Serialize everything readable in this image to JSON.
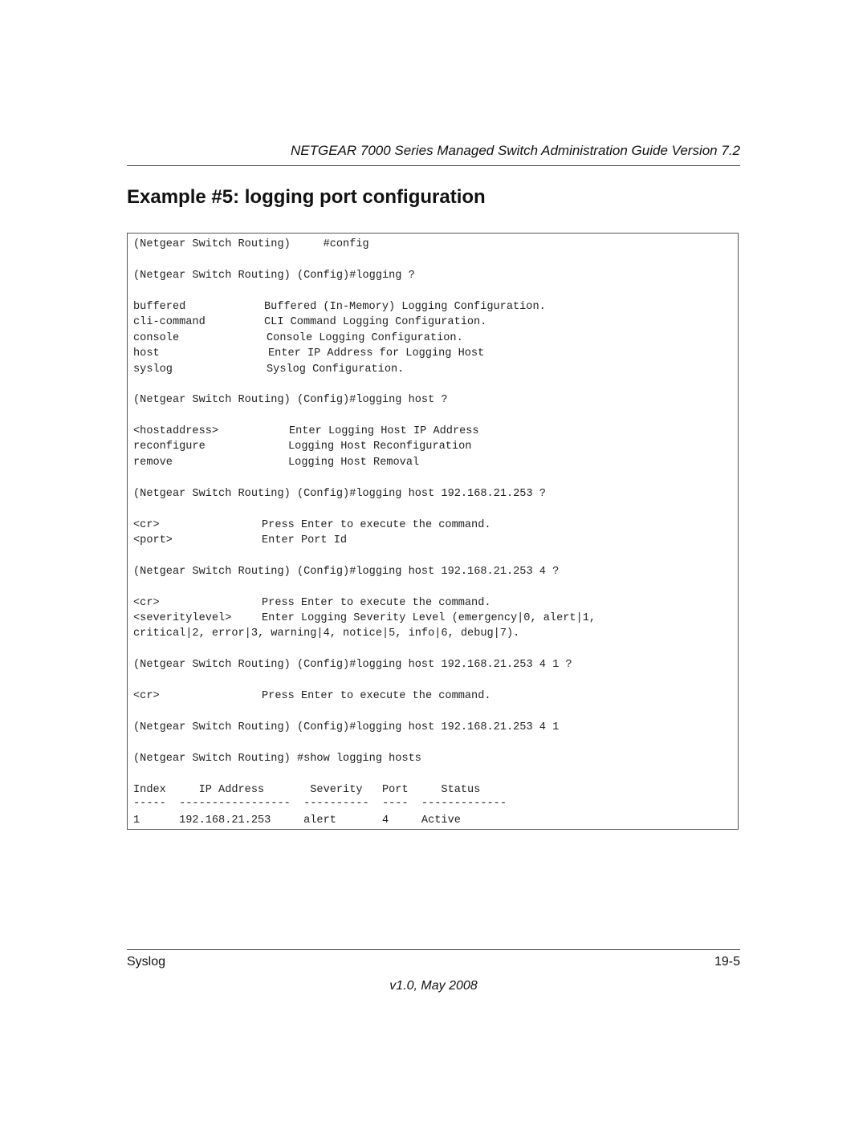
{
  "header": {
    "title": "NETGEAR 7000 Series Managed Switch Administration Guide Version 7.2"
  },
  "section_title": "Example #5: logging port configuration",
  "code": {
    "cmd1": "(Netgear Switch Routing)     #config",
    "cmd2": "(Netgear Switch Routing) (Config)#logging ?",
    "opts1": [
      {
        "k": "buffered",
        "v": "Buffered (In-Memory) Logging Configuration."
      },
      {
        "k": "cli-command",
        "v": "CLI Command Logging Configuration."
      },
      {
        "k": "console",
        "v": "Console Logging Configuration."
      },
      {
        "k": "host",
        "v": "Enter IP Address for Logging Host"
      },
      {
        "k": "syslog",
        "v": "Syslog Configuration."
      }
    ],
    "cmd3": "(Netgear Switch Routing) (Config)#logging host ?",
    "opts2": [
      {
        "k": "<hostaddress>",
        "v": "Enter Logging Host IP Address"
      },
      {
        "k": "reconfigure",
        "v": "Logging Host Reconfiguration"
      },
      {
        "k": "remove",
        "v": "Logging Host Removal"
      }
    ],
    "cmd4": "(Netgear Switch Routing) (Config)#logging host 192.168.21.253 ?",
    "opts3": [
      {
        "k": "<cr>",
        "v": "Press Enter to execute the command."
      },
      {
        "k": "<port>",
        "v": "Enter Port Id"
      }
    ],
    "cmd5": "(Netgear Switch Routing) (Config)#logging host 192.168.21.253 4 ?",
    "opts4": [
      {
        "k": "<cr>",
        "v": "Press Enter to execute the command."
      },
      {
        "k": "<severitylevel>",
        "v": "Enter Logging Severity Level (emergency|0, alert|1,"
      }
    ],
    "opts4_cont": "critical|2, error|3, warning|4, notice|5, info|6, debug|7).",
    "cmd6": "(Netgear Switch Routing) (Config)#logging host 192.168.21.253 4 1 ?",
    "opts5": [
      {
        "k": "<cr>",
        "v": "Press Enter to execute the command."
      }
    ],
    "cmd7": "(Netgear Switch Routing) (Config)#logging host 192.168.21.253 4 1",
    "cmd8": "(Netgear Switch Routing) #show logging hosts",
    "table_header": "Index     IP Address       Severity   Port     Status",
    "table_sep": "-----  -----------------  ----------  ----  -------------",
    "table_row": "1      192.168.21.253     alert       4     Active"
  },
  "footer": {
    "left": "Syslog",
    "right": "19-5",
    "version": "v1.0, May 2008"
  }
}
